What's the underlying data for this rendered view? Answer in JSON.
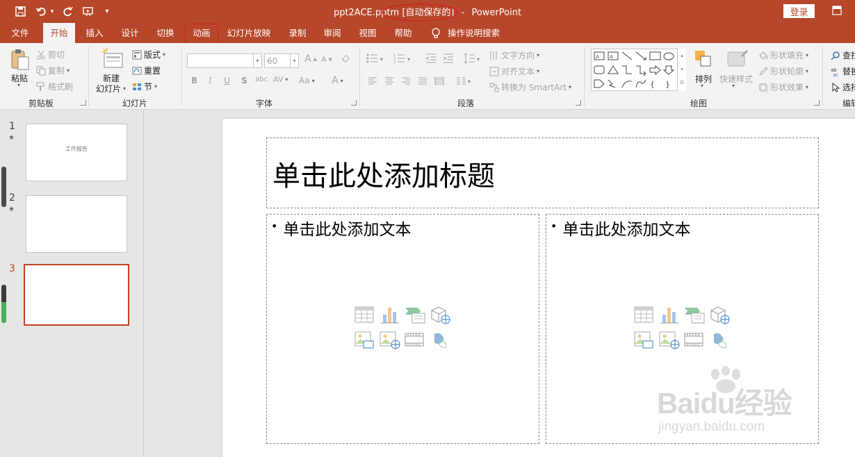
{
  "app": {
    "filename": "ppt2ACE.pptm",
    "autosave": "[自动保存的]",
    "separator": "-",
    "product": "PowerPoint",
    "login": "登录",
    "accent": "#b7472a"
  },
  "tabs": [
    "文件",
    "开始",
    "插入",
    "设计",
    "切换",
    "动画",
    "幻灯片放映",
    "录制",
    "审阅",
    "视图",
    "帮助",
    "操作说明搜索"
  ],
  "ribbon": {
    "clipboard": {
      "paste": "粘贴",
      "cut": "剪切",
      "copy": "复制",
      "format_painter": "格式刷",
      "label": "剪贴板"
    },
    "slides": {
      "new_slide_l1": "新建",
      "new_slide_l2": "幻灯片",
      "layout": "版式",
      "reset": "重置",
      "section": "节",
      "label": "幻灯片"
    },
    "font": {
      "size_value": "60",
      "bold": "B",
      "italic": "I",
      "underline": "U",
      "shadow": "S",
      "spacing": "AV",
      "case": "Aa",
      "color": "A",
      "grow": "A",
      "shrink": "A",
      "label": "字体"
    },
    "paragraph": {
      "text_direction": "文字方向",
      "align_text": "对齐文本",
      "smartart": "转换为 SmartArt",
      "label": "段落"
    },
    "drawing": {
      "arrange": "排列",
      "quick_styles": "快速样式",
      "shape_fill": "形状填充",
      "shape_outline": "形状轮廓",
      "shape_effects": "形状效果",
      "label": "绘图"
    },
    "editing": {
      "find": "查找",
      "replace": "替换",
      "select": "选择",
      "label": "编辑"
    }
  },
  "slides_pane": [
    {
      "number": "1",
      "star": "★",
      "title": "工作报告"
    },
    {
      "number": "2",
      "star": "★",
      "title": ""
    },
    {
      "number": "3",
      "star": "",
      "title": ""
    }
  ],
  "slide": {
    "title_placeholder": "单击此处添加标题",
    "left_placeholder": "单击此处添加文本",
    "right_placeholder": "单击此处添加文本",
    "bullet": "•"
  },
  "watermark": {
    "big": "Baidu经验",
    "small": "jingyan.baidu.com"
  }
}
